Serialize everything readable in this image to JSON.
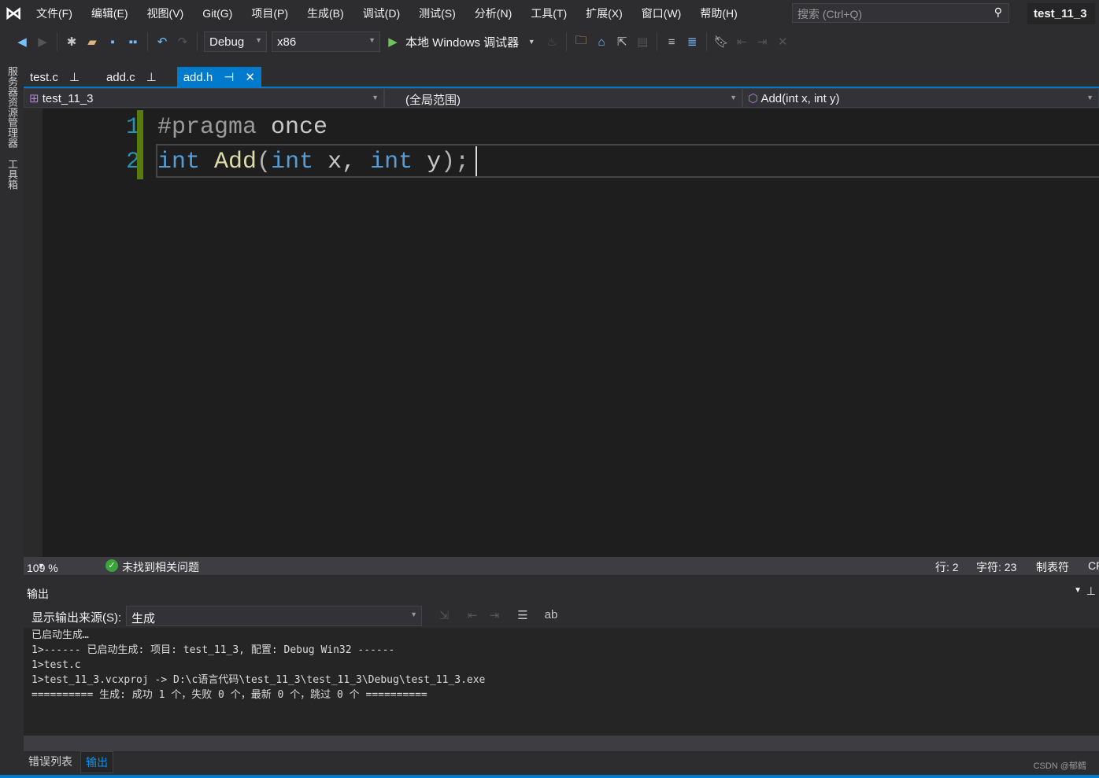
{
  "menubar": {
    "items": [
      "文件(F)",
      "编辑(E)",
      "视图(V)",
      "Git(G)",
      "项目(P)",
      "生成(B)",
      "调试(D)",
      "测试(S)",
      "分析(N)",
      "工具(T)",
      "扩展(X)",
      "窗口(W)",
      "帮助(H)"
    ],
    "search_placeholder": "搜索 (Ctrl+Q)",
    "window_title": "test_11_3"
  },
  "toolbar": {
    "config": "Debug",
    "platform": "x86",
    "run_label": "本地 Windows 调试器"
  },
  "side": {
    "server_explorer": "服务器资源管理器",
    "toolbox": "工具箱"
  },
  "tabs": [
    {
      "label": "test.c"
    },
    {
      "label": "add.c"
    },
    {
      "label": "add.h",
      "active": true
    }
  ],
  "nav": {
    "project": "test_11_3",
    "scope": "(全局范围)",
    "member": "Add(int x, int y)"
  },
  "editor": {
    "lines": [
      "1",
      "2"
    ],
    "line1": {
      "directive": "#pragma",
      "rest": " once"
    },
    "line2": {
      "t1": "int",
      "sp1": " ",
      "fn": "Add",
      "p1": "(",
      "t2": "int",
      "v1": " x, ",
      "t3": "int",
      "v2": " y",
      "p2": ");"
    }
  },
  "status": {
    "zoom": "109 %",
    "issues": "未找到相关问题",
    "line": "行: 2",
    "char": "字符: 23",
    "tabs": "制表符",
    "eol": "CR"
  },
  "output": {
    "title": "输出",
    "source_label": "显示输出来源(S):",
    "source_value": "生成",
    "lines": [
      "已启动生成…",
      "1>------ 已启动生成: 项目: test_11_3, 配置: Debug Win32 ------",
      "1>test.c",
      "1>test_11_3.vcxproj -> D:\\c语言代码\\test_11_3\\test_11_3\\Debug\\test_11_3.exe",
      "========== 生成: 成功 1 个，失败 0 个，最新 0 个，跳过 0 个 =========="
    ]
  },
  "bottom_tabs": [
    "错误列表",
    "输出"
  ],
  "watermark": "CSDN @郁鳕",
  "colors": {
    "accent": "#007acc",
    "keyword": "#569cd6",
    "function": "#dcdcaa",
    "line_number": "#2b91af",
    "change_bar": "#587c0c"
  }
}
